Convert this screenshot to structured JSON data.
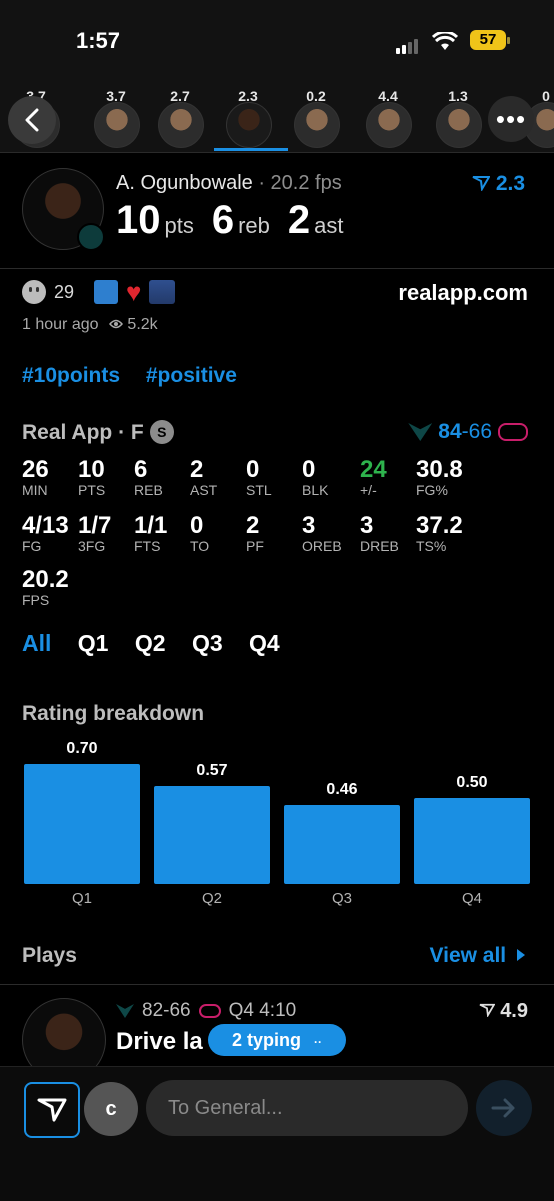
{
  "status": {
    "time": "1:57",
    "battery": "57"
  },
  "players_strip": {
    "ratings": [
      "3.7",
      "3.7",
      "2.7",
      "2.3",
      "0.2",
      "4.4",
      "1.3",
      "0"
    ],
    "selected_index": 3
  },
  "header": {
    "name": "A. Ogunbowale",
    "fps": "· 20.2 fps",
    "rating": "2.3",
    "pts": "10",
    "pts_label": "pts",
    "reb": "6",
    "reb_label": "reb",
    "ast": "2",
    "ast_label": "ast"
  },
  "post": {
    "reaction_count": "29",
    "site": "realapp.com",
    "time_ago": "1 hour ago",
    "views": "5.2k",
    "tags": [
      "#10points",
      "#positive"
    ]
  },
  "game": {
    "title": "Real App · F",
    "badge": "S",
    "score_home": "84",
    "score_sep": "-",
    "score_away": "66",
    "stats_row1": [
      {
        "v": "26",
        "l": "MIN"
      },
      {
        "v": "10",
        "l": "PTS"
      },
      {
        "v": "6",
        "l": "REB"
      },
      {
        "v": "2",
        "l": "AST"
      },
      {
        "v": "0",
        "l": "STL"
      },
      {
        "v": "0",
        "l": "BLK"
      },
      {
        "v": "24",
        "l": "+/-"
      },
      {
        "v": "30.8",
        "l": "FG%"
      }
    ],
    "stats_row2": [
      {
        "v": "4/13",
        "l": "FG"
      },
      {
        "v": "1/7",
        "l": "3FG"
      },
      {
        "v": "1/1",
        "l": "FTS"
      },
      {
        "v": "0",
        "l": "TO"
      },
      {
        "v": "2",
        "l": "PF"
      },
      {
        "v": "3",
        "l": "OREB"
      },
      {
        "v": "3",
        "l": "DREB"
      },
      {
        "v": "37.2",
        "l": "TS%"
      }
    ],
    "stats_row3": [
      {
        "v": "20.2",
        "l": "FPS"
      }
    ],
    "quarter_tabs": [
      "All",
      "Q1",
      "Q2",
      "Q3",
      "Q4"
    ],
    "active_tab": "All"
  },
  "rating_breakdown": {
    "title": "Rating breakdown"
  },
  "chart_data": {
    "type": "bar",
    "categories": [
      "Q1",
      "Q2",
      "Q3",
      "Q4"
    ],
    "values": [
      0.7,
      0.57,
      0.46,
      0.5
    ],
    "labels": [
      "0.70",
      "0.57",
      "0.46",
      "0.50"
    ],
    "ylim": [
      0,
      0.75
    ],
    "color": "#1a8fe3"
  },
  "plays": {
    "title": "Plays",
    "view_all": "View all",
    "item": {
      "score": "82-66",
      "clock": "Q4 4:10",
      "rating": "4.9",
      "desc": "Drive la"
    },
    "typing": "2 typing"
  },
  "composer": {
    "c_label": "c",
    "placeholder": "To General..."
  },
  "colors": {
    "accent": "#1a8fe3",
    "positive": "#2eb34d",
    "background": "#000000"
  }
}
